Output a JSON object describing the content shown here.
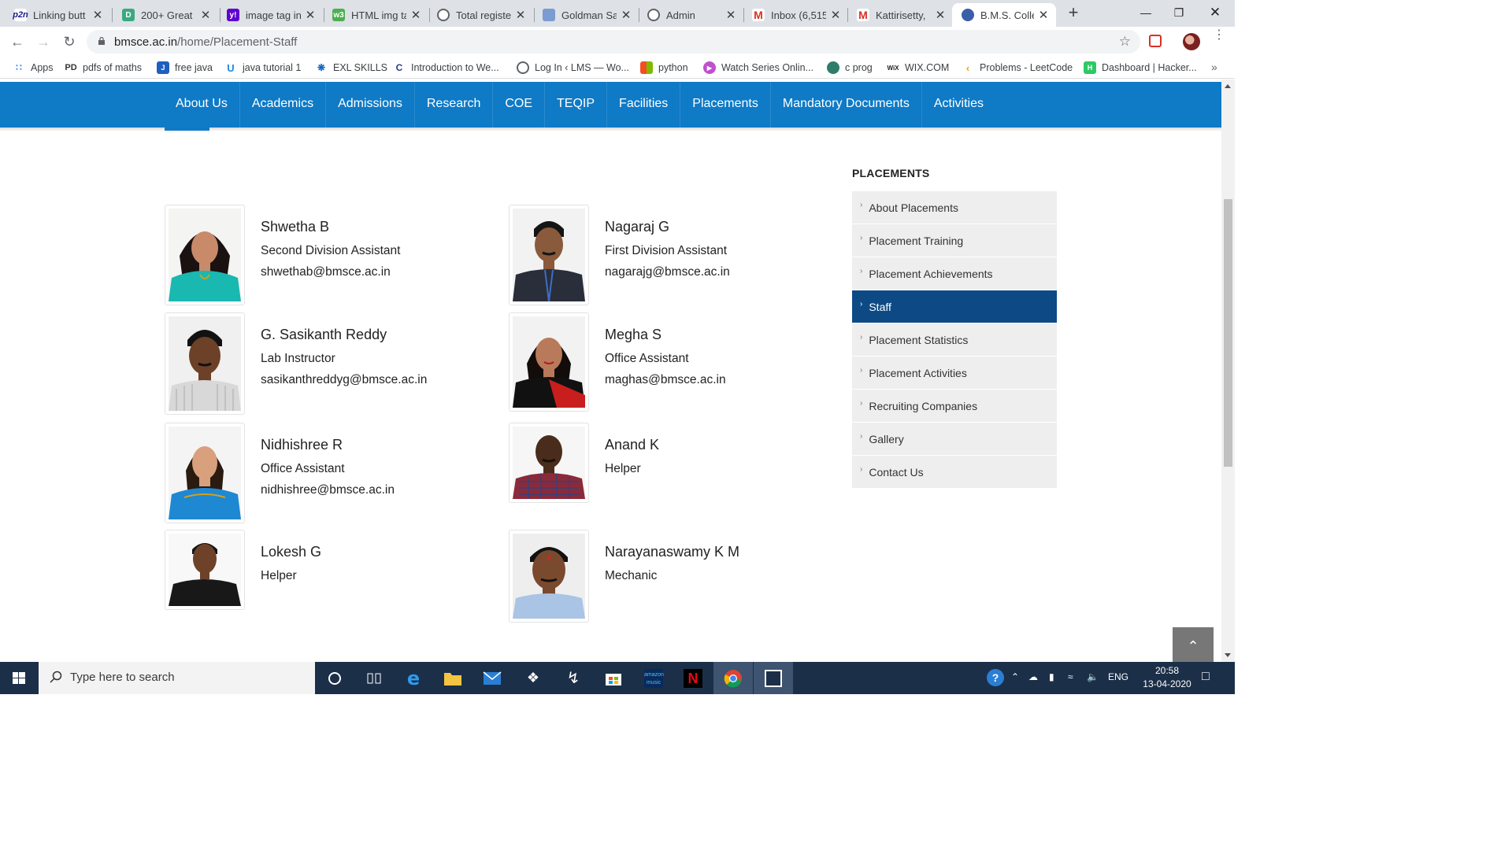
{
  "browser": {
    "tabs": [
      {
        "title": "Linking butt",
        "favicon": "p2n-icon",
        "color": "#1a1a8c",
        "active": false
      },
      {
        "title": "200+ Great",
        "favicon": "doc-icon",
        "color": "#3aa981",
        "active": false
      },
      {
        "title": "image tag in",
        "favicon": "yahoo-icon",
        "color": "#5f01d1",
        "active": false
      },
      {
        "title": "HTML img ta",
        "favicon": "w3-icon",
        "color": "#4caf50",
        "active": false
      },
      {
        "title": "Total registe",
        "favicon": "globe-icon",
        "color": "#5f6368",
        "active": false
      },
      {
        "title": "Goldman Sa",
        "favicon": "page-icon",
        "color": "#7b9bd1",
        "active": false
      },
      {
        "title": "Admin",
        "favicon": "globe-icon",
        "color": "#5f6368",
        "active": false
      },
      {
        "title": "Inbox (6,515",
        "favicon": "gmail-icon",
        "color": "#d93025",
        "active": false
      },
      {
        "title": "Kattirisetty,",
        "favicon": "gmail-icon",
        "color": "#d93025",
        "active": false
      },
      {
        "title": "B.M.S. Colle",
        "favicon": "bms-icon",
        "color": "#3b5ea8",
        "active": true
      }
    ],
    "new_tab": "+",
    "url_host": "bmsce.ac.in",
    "url_path": "/home/Placement-Staff",
    "bookmarks": [
      {
        "label": "Apps",
        "icon": "apps-icon",
        "color": "#4285f4"
      },
      {
        "label": "pdfs of maths",
        "icon": "pd-icon",
        "color": "#333333"
      },
      {
        "label": "free java",
        "icon": "java-icon",
        "color": "#1f5fbf"
      },
      {
        "label": "java tutorial 1",
        "icon": "u-icon",
        "color": "#1e88e5"
      },
      {
        "label": "EXL SKILLS",
        "icon": "exl-icon",
        "color": "#1565c0"
      },
      {
        "label": "Introduction to We...",
        "icon": "c-icon",
        "color": "#2d3b8c"
      },
      {
        "label": "Log In ‹ LMS — Wo...",
        "icon": "globe-icon",
        "color": "#5f6368"
      },
      {
        "label": "python",
        "icon": "ms-icon",
        "color": "#f25022"
      },
      {
        "label": "Watch Series Onlin...",
        "icon": "play-icon",
        "color": "#c04fcf"
      },
      {
        "label": "c prog",
        "icon": "cprog-icon",
        "color": "#2e7d6b"
      },
      {
        "label": "WIX.COM",
        "icon": "wix-icon",
        "color": "#222222"
      },
      {
        "label": "Problems - LeetCode",
        "icon": "leetcode-icon",
        "color": "#f89f1b"
      },
      {
        "label": "Dashboard | Hacker...",
        "icon": "hackerrank-icon",
        "color": "#2ec866"
      }
    ],
    "bookmarks_more": "»"
  },
  "site": {
    "nav": [
      "About Us",
      "Academics",
      "Admissions",
      "Research",
      "COE",
      "TEQIP",
      "Facilities",
      "Placements",
      "Mandatory Documents",
      "Activities"
    ],
    "staff": [
      {
        "name": "Shwetha B",
        "role": "Second Division Assistant",
        "email": "shwethab@bmsce.ac.in",
        "photo": "woman-teal-saree"
      },
      {
        "name": "Nagaraj G",
        "role": "First Division Assistant",
        "email": "nagarajg@bmsce.ac.in",
        "photo": "man-dark-shirt"
      },
      {
        "name": "G. Sasikanth Reddy",
        "role": "Lab Instructor",
        "email": "sasikanthreddyg@bmsce.ac.in",
        "photo": "man-striped-shirt"
      },
      {
        "name": "Megha S",
        "role": "Office Assistant",
        "email": "maghas@bmsce.ac.in",
        "photo": "woman-red-saree"
      },
      {
        "name": "Nidhishree R",
        "role": "Office Assistant",
        "email": "nidhishree@bmsce.ac.in",
        "photo": "woman-blue-saree"
      },
      {
        "name": "Anand K",
        "role": "Helper",
        "email": "",
        "photo": "man-checked-shirt"
      },
      {
        "name": "Lokesh G",
        "role": "Helper",
        "email": "",
        "photo": "man-black-shirt"
      },
      {
        "name": "Narayanaswamy K M",
        "role": "Mechanic",
        "email": "",
        "photo": "man-blue-shirt"
      }
    ],
    "sidebar_title": "PLACEMENTS",
    "sidebar_items": [
      {
        "label": "About Placements",
        "active": false
      },
      {
        "label": "Placement Training",
        "active": false
      },
      {
        "label": "Placement Achievements",
        "active": false
      },
      {
        "label": "Staff",
        "active": true
      },
      {
        "label": "Placement Statistics",
        "active": false
      },
      {
        "label": "Placement Activities",
        "active": false
      },
      {
        "label": "Recruiting Companies",
        "active": false
      },
      {
        "label": "Gallery",
        "active": false
      },
      {
        "label": "Contact Us",
        "active": false
      }
    ],
    "back_to_top": "⌃",
    "colors": {
      "nav_blue": "#0f7ac6",
      "active_side": "#0d4a85",
      "side_bg": "#eeeeee"
    }
  },
  "taskbar": {
    "search_placeholder": "Type here to search",
    "apps": [
      "cortana-icon",
      "task-view-icon",
      "edge-icon",
      "file-explorer-icon",
      "mail-icon",
      "dropbox-icon",
      "lightning-icon",
      "store-icon",
      "amazon-music-icon",
      "netflix-icon",
      "chrome-icon",
      "app-icon"
    ],
    "tray_lang": "ENG",
    "time": "20:58",
    "date": "13-04-2020"
  }
}
